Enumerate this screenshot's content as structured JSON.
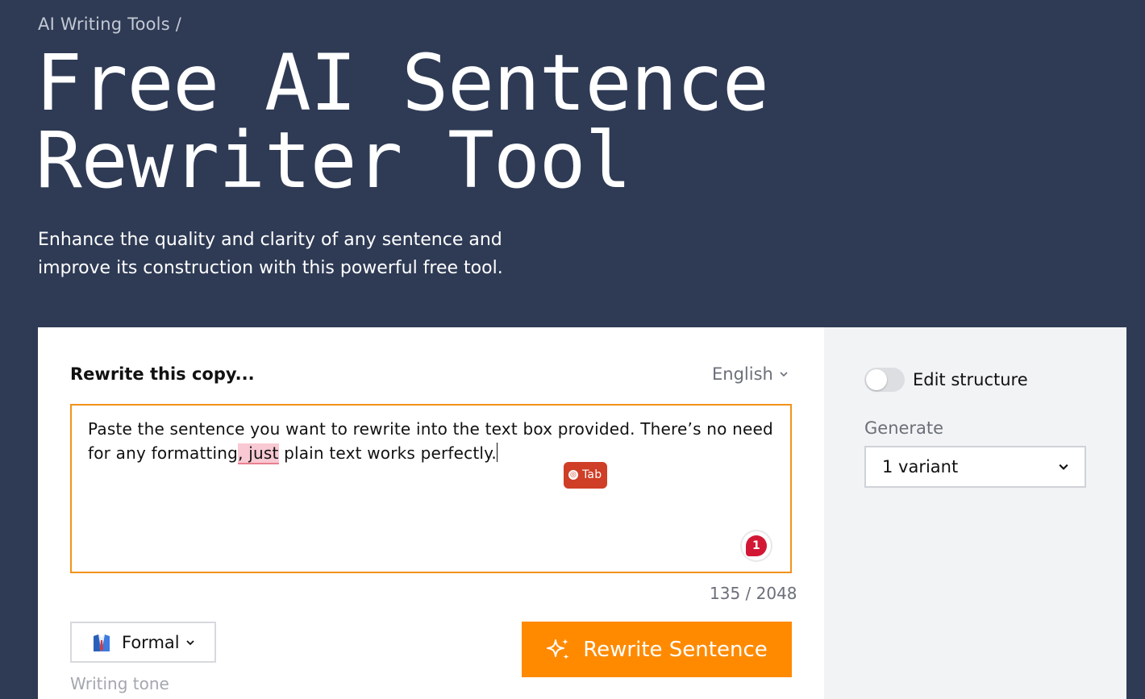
{
  "breadcrumb": {
    "parent": "AI Writing Tools",
    "separator": "/"
  },
  "title": "Free AI Sentence Rewriter Tool",
  "subtitle": "Enhance the quality and clarity of any sentence and improve its construction with this powerful free tool.",
  "editor": {
    "label": "Rewrite this copy...",
    "language": "English",
    "text_before": "Paste the sentence you want to rewrite into the text box provided. There’s no need for any formatting",
    "text_highlight": ", just",
    "text_after": " plain text works perfectly.",
    "suggestion_chip": "Tab",
    "issue_count": "1",
    "char_count": "135 / 2048"
  },
  "tone": {
    "value": "Formal",
    "caption": "Writing tone"
  },
  "action": {
    "label": "Rewrite Sentence"
  },
  "settings": {
    "toggle_label": "Edit structure",
    "toggle_on": false,
    "generate_label": "Generate",
    "variants_value": "1 variant"
  },
  "colors": {
    "background": "#2f3b55",
    "accent": "#ff8a00",
    "input_border": "#f29219",
    "error_badge": "#d21735",
    "highlight": "#f8c9d2"
  }
}
